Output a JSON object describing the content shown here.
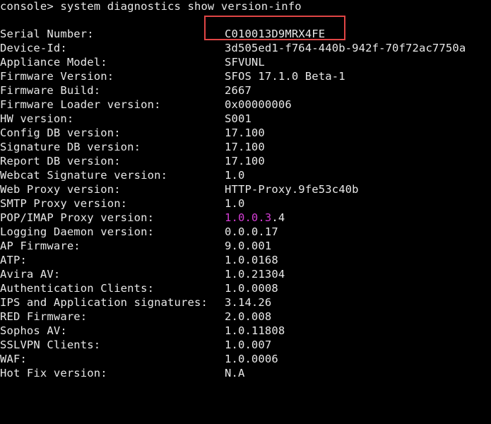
{
  "terminal": {
    "command_line": "console> system diagnostics show version-info",
    "highlight_color": "#e04545",
    "text_color": "#e8e8e8",
    "background_color": "#000000",
    "rows": [
      {
        "label": "Serial Number:",
        "value": "C010013D9MRX4FE"
      },
      {
        "label": "Device-Id:",
        "value": "3d505ed1-f764-440b-942f-70f72ac7750a"
      },
      {
        "label": "Appliance Model:",
        "value": "SFVUNL"
      },
      {
        "label": "Firmware Version:",
        "value": "SFOS 17.1.0 Beta-1"
      },
      {
        "label": "Firmware Build:",
        "value": "2667"
      },
      {
        "label": "Firmware Loader version:",
        "value": "0x00000006"
      },
      {
        "label": "HW version:",
        "value": "S001"
      },
      {
        "label": "Config DB version:",
        "value": "17.100"
      },
      {
        "label": "Signature DB version:",
        "value": "17.100"
      },
      {
        "label": "Report DB version:",
        "value": "17.100"
      },
      {
        "label": "Webcat Signature version:",
        "value": "1.0"
      },
      {
        "label": "Web Proxy version:",
        "value": "HTTP-Proxy.9fe53c40b"
      },
      {
        "label": "SMTP Proxy version:",
        "value": "1.0"
      },
      {
        "label": "POP/IMAP Proxy version:",
        "value_magenta": "1.0.0.3",
        "value_tail": ".4"
      },
      {
        "label": "Logging Daemon version:",
        "value": "0.0.0.17"
      },
      {
        "label": "AP Firmware:",
        "value": "9.0.001"
      },
      {
        "label": "ATP:",
        "value": "1.0.0168"
      },
      {
        "label": "Avira AV:",
        "value": "1.0.21304"
      },
      {
        "label": "Authentication Clients:",
        "value": "1.0.0008"
      },
      {
        "label": "IPS and Application signatures:",
        "value": "3.14.26"
      },
      {
        "label": "RED Firmware:",
        "value": "2.0.008"
      },
      {
        "label": "Sophos AV:",
        "value": "1.0.11808"
      },
      {
        "label": "SSLVPN Clients:",
        "value": "1.0.007"
      },
      {
        "label": "WAF:",
        "value": "1.0.0006"
      },
      {
        "label": "Hot Fix version:",
        "value": "N.A"
      }
    ]
  }
}
